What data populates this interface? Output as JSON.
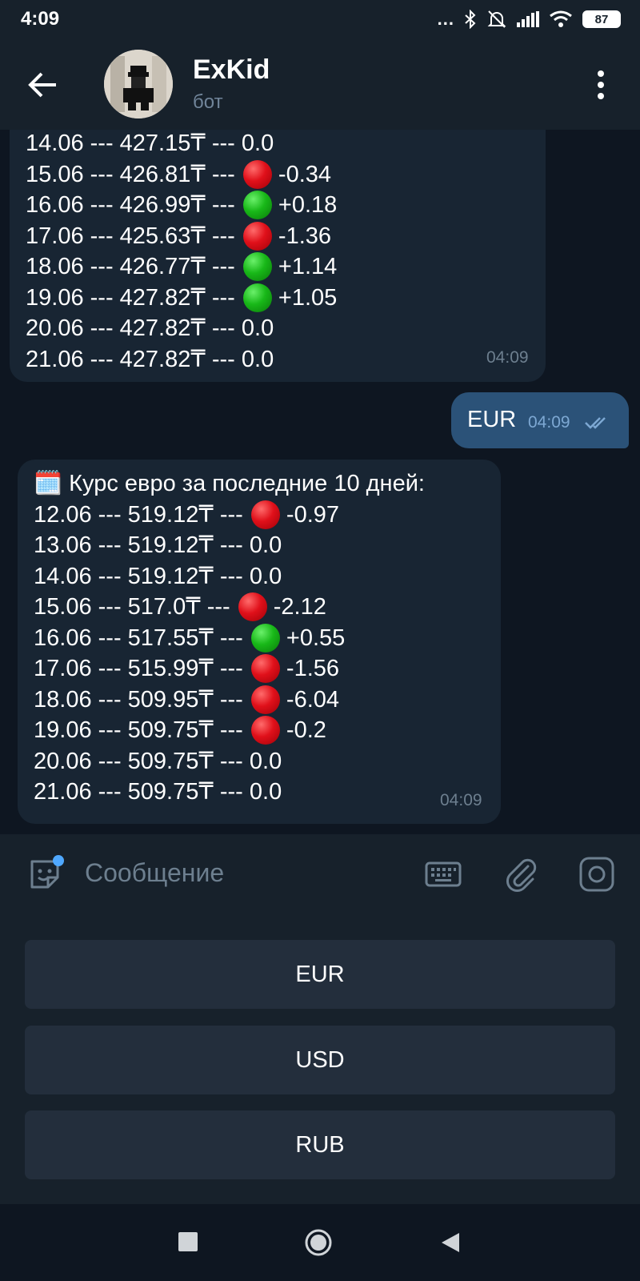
{
  "status": {
    "time": "4:09",
    "dots": "...",
    "battery": "87"
  },
  "header": {
    "title": "ExKid",
    "subtitle": "бот"
  },
  "messages": {
    "usd_lines": [
      {
        "text": "14.06 --- 427.15₸ --- ",
        "dot": "",
        "change": "0.0"
      },
      {
        "text": "15.06 --- 426.81₸ --- ",
        "dot": "red",
        "change": "-0.34"
      },
      {
        "text": "16.06 --- 426.99₸ --- ",
        "dot": "green",
        "change": "+0.18"
      },
      {
        "text": "17.06 --- 425.63₸ --- ",
        "dot": "red",
        "change": "-1.36"
      },
      {
        "text": "18.06 --- 426.77₸ --- ",
        "dot": "green",
        "change": "+1.14"
      },
      {
        "text": "19.06 --- 427.82₸ --- ",
        "dot": "green",
        "change": "+1.05"
      },
      {
        "text": "20.06 --- 427.82₸ --- ",
        "dot": "",
        "change": "0.0"
      },
      {
        "text": "21.06 --- 427.82₸ --- ",
        "dot": "",
        "change": "0.0"
      }
    ],
    "usd_time": "04:09",
    "outgoing_text": "EUR",
    "outgoing_time": "04:09",
    "eur_heading": "🗓️ Курс евро за последние 10 дней:",
    "eur_lines": [
      {
        "text": "12.06 --- 519.12₸ --- ",
        "dot": "red",
        "change": "-0.97"
      },
      {
        "text": "13.06 --- 519.12₸ --- ",
        "dot": "",
        "change": "0.0"
      },
      {
        "text": "14.06 --- 519.12₸ --- ",
        "dot": "",
        "change": "0.0"
      },
      {
        "text": "15.06 --- 517.0₸ --- ",
        "dot": "red",
        "change": "-2.12"
      },
      {
        "text": "16.06 --- 517.55₸ --- ",
        "dot": "green",
        "change": "+0.55"
      },
      {
        "text": "17.06 --- 515.99₸ --- ",
        "dot": "red",
        "change": "-1.56"
      },
      {
        "text": "18.06 --- 509.95₸ --- ",
        "dot": "red",
        "change": "-6.04"
      },
      {
        "text": "19.06 --- 509.75₸ --- ",
        "dot": "red",
        "change": "-0.2"
      },
      {
        "text": "20.06 --- 509.75₸ --- ",
        "dot": "",
        "change": "0.0"
      },
      {
        "text": "21.06 --- 509.75₸ --- ",
        "dot": "",
        "change": "0.0"
      }
    ],
    "eur_time": "04:09"
  },
  "input": {
    "placeholder": "Сообщение"
  },
  "keyboard": {
    "buttons": [
      "EUR",
      "USD",
      "RUB"
    ]
  },
  "colors": {
    "background": "#0e1621",
    "bar": "#17212b",
    "bubble_in": "#182533",
    "bubble_out": "#2b5278",
    "accent": "#4fa8ff"
  }
}
